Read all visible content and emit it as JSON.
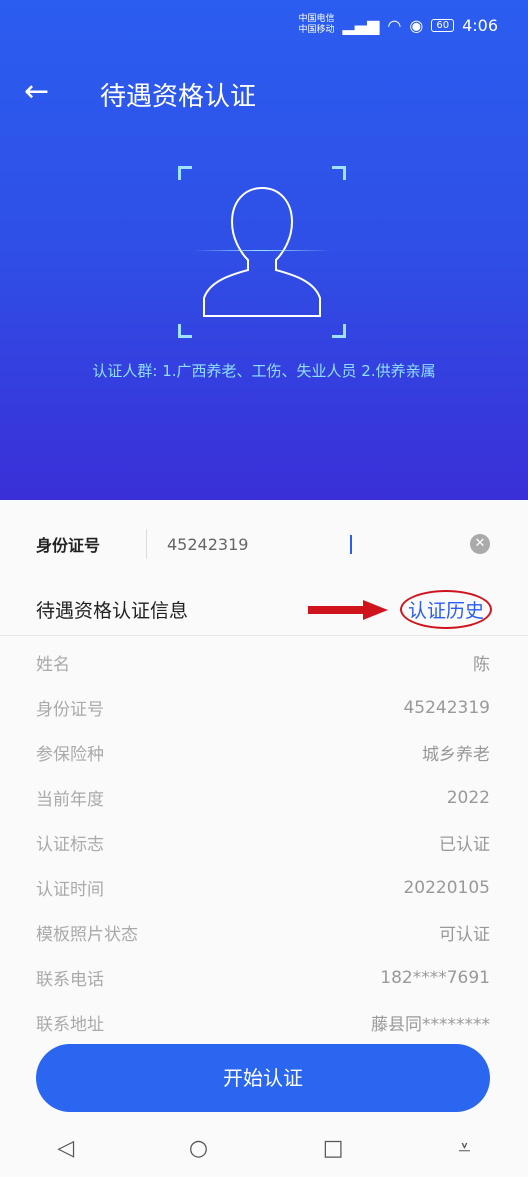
{
  "status": {
    "carrier1": "中国电信",
    "carrier2": "中国移动",
    "time": "4:06",
    "battery": "60"
  },
  "header": {
    "back": "←",
    "title": "待遇资格认证"
  },
  "hero": {
    "group_text": "认证人群: 1.广西养老、工伤、失业人员   2.供养亲属"
  },
  "id_input": {
    "label": "身份证号",
    "value": "45242319"
  },
  "section": {
    "title": "待遇资格认证信息",
    "history_link": "认证历史",
    "annotation_color": "#d0141e"
  },
  "rows": [
    {
      "label": "姓名",
      "value": "陈"
    },
    {
      "label": "身份证号",
      "value": "45242319"
    },
    {
      "label": "参保险种",
      "value": "城乡养老"
    },
    {
      "label": "当前年度",
      "value": "2022"
    },
    {
      "label": "认证标志",
      "value": "已认证"
    },
    {
      "label": "认证时间",
      "value": "20220105"
    },
    {
      "label": "模板照片状态",
      "value": "可认证"
    },
    {
      "label": "联系电话",
      "value": "182****7691"
    },
    {
      "label": "联系地址",
      "value": "藤县同********"
    }
  ],
  "button": {
    "start": "开始认证"
  },
  "colors": {
    "accent": "#2b66f0",
    "hero_top": "#2b5df0",
    "hero_bottom": "#3a2fd8"
  }
}
